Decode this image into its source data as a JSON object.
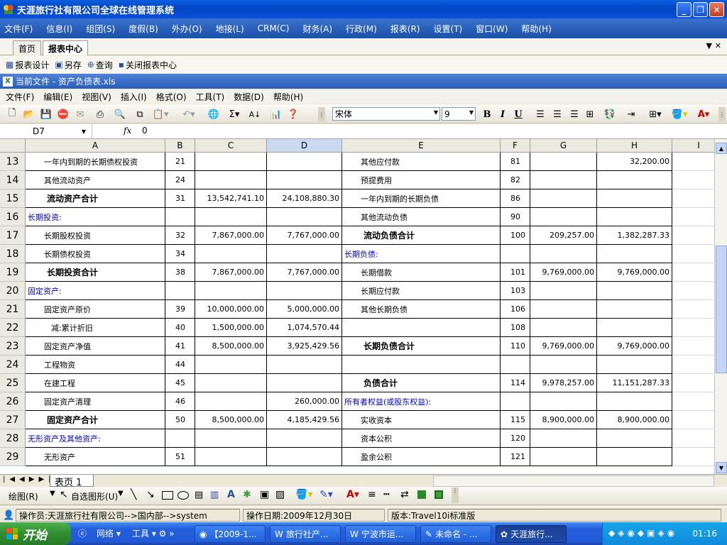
{
  "window": {
    "title": "天涯旅行社有限公司全球在线管理系统"
  },
  "app_menu": [
    "文件(F)",
    "信息(I)",
    "组团(S)",
    "度假(B)",
    "外办(O)",
    "地接(L)",
    "CRM(C)",
    "财务(A)",
    "行政(M)",
    "报表(R)",
    "设置(T)",
    "窗口(W)",
    "帮助(H)"
  ],
  "tabs": [
    {
      "label": "首页",
      "active": false
    },
    {
      "label": "报表中心",
      "active": true
    }
  ],
  "report_toolbar": {
    "design": "报表设计",
    "save_as": "另存",
    "query": "查询",
    "close": "关闭报表中心"
  },
  "file_bar": {
    "label": "当前文件 - 资产负债表.xls"
  },
  "excel_menu": [
    "文件(F)",
    "编辑(E)",
    "视图(V)",
    "插入(I)",
    "格式(O)",
    "工具(T)",
    "数据(D)",
    "帮助(H)"
  ],
  "format_toolbar": {
    "font": "宋体",
    "size": "9"
  },
  "formula_bar": {
    "name_box": "D7",
    "fx": "fx",
    "value": "0"
  },
  "columns": [
    "A",
    "B",
    "C",
    "D",
    "E",
    "F",
    "G",
    "H",
    "I"
  ],
  "rows": [
    {
      "n": "13",
      "a": "一年内到期的长期债权投资",
      "b": "21",
      "c": "",
      "d": "",
      "e": "其他应付款",
      "f": "81",
      "g": "",
      "h": "32,200.00"
    },
    {
      "n": "14",
      "a": "其他流动资产",
      "b": "24",
      "c": "",
      "d": "",
      "e": "预提费用",
      "f": "82",
      "g": "",
      "h": ""
    },
    {
      "n": "15",
      "a": "流动资产合计",
      "b": "31",
      "c": "13,542,741.10",
      "d": "24,108,880.30",
      "e": "一年内到期的长期负债",
      "f": "86",
      "g": "",
      "h": ""
    },
    {
      "n": "16",
      "a": "长期投资:",
      "b": "",
      "c": "",
      "d": "",
      "e": "其他流动负债",
      "f": "90",
      "g": "",
      "h": ""
    },
    {
      "n": "17",
      "a": "长期股权投资",
      "b": "32",
      "c": "7,867,000.00",
      "d": "7,767,000.00",
      "e": "流动负债合计",
      "f": "100",
      "g": "209,257.00",
      "h": "1,382,287.33"
    },
    {
      "n": "18",
      "a": "长期债权投资",
      "b": "34",
      "c": "",
      "d": "",
      "e": "长期负债:",
      "f": "",
      "g": "",
      "h": ""
    },
    {
      "n": "19",
      "a": "长期投资合计",
      "b": "38",
      "c": "7,867,000.00",
      "d": "7,767,000.00",
      "e": "长期借款",
      "f": "101",
      "g": "9,769,000.00",
      "h": "9,769,000.00"
    },
    {
      "n": "20",
      "a": "固定资产:",
      "b": "",
      "c": "",
      "d": "",
      "e": "长期应付款",
      "f": "103",
      "g": "",
      "h": ""
    },
    {
      "n": "21",
      "a": "固定资产原价",
      "b": "39",
      "c": "10,000,000.00",
      "d": "5,000,000.00",
      "e": "其他长期负债",
      "f": "106",
      "g": "",
      "h": ""
    },
    {
      "n": "22",
      "a": "减:累计折旧",
      "b": "40",
      "c": "1,500,000.00",
      "d": "1,074,570.44",
      "e": "",
      "f": "108",
      "g": "",
      "h": ""
    },
    {
      "n": "23",
      "a": "固定资产净值",
      "b": "41",
      "c": "8,500,000.00",
      "d": "3,925,429.56",
      "e": "长期负债合计",
      "f": "110",
      "g": "9,769,000.00",
      "h": "9,769,000.00"
    },
    {
      "n": "24",
      "a": "工程物资",
      "b": "44",
      "c": "",
      "d": "",
      "e": "",
      "f": "",
      "g": "",
      "h": ""
    },
    {
      "n": "25",
      "a": "在建工程",
      "b": "45",
      "c": "",
      "d": "",
      "e": "负债合计",
      "f": "114",
      "g": "9,978,257.00",
      "h": "11,151,287.33"
    },
    {
      "n": "26",
      "a": "固定资产清理",
      "b": "46",
      "c": "",
      "d": "260,000.00",
      "e": "所有者权益(或股东权益):",
      "f": "",
      "g": "",
      "h": ""
    },
    {
      "n": "27",
      "a": "固定资产合计",
      "b": "50",
      "c": "8,500,000.00",
      "d": "4,185,429.56",
      "e": "实收资本",
      "f": "115",
      "g": "8,900,000.00",
      "h": "8,900,000.00"
    },
    {
      "n": "28",
      "a": "无形资产及其他资产:",
      "b": "",
      "c": "",
      "d": "",
      "e": "资本公积",
      "f": "120",
      "g": "",
      "h": ""
    },
    {
      "n": "29",
      "a": "无形资产",
      "b": "51",
      "c": "",
      "d": "",
      "e": "盈余公积",
      "f": "121",
      "g": "",
      "h": ""
    }
  ],
  "sheet_tab": "表页 1",
  "draw_toolbar": {
    "draw": "绘图(R)",
    "autoshape": "自选图形(U)"
  },
  "status": {
    "operator": "操作员:天涯旅行社有限公司-->国内部-->system",
    "date": "操作日期:2009年12月30日",
    "version": "版本:Travel10i标准版"
  },
  "taskbar": {
    "start": "开始",
    "quick1": "网络",
    "quick2": "工具",
    "tasks": [
      "【2009-1...",
      "旅行社产...",
      "宁波市运...",
      "未命名 - ...",
      "天涯旅行..."
    ],
    "clock": "01:16"
  }
}
